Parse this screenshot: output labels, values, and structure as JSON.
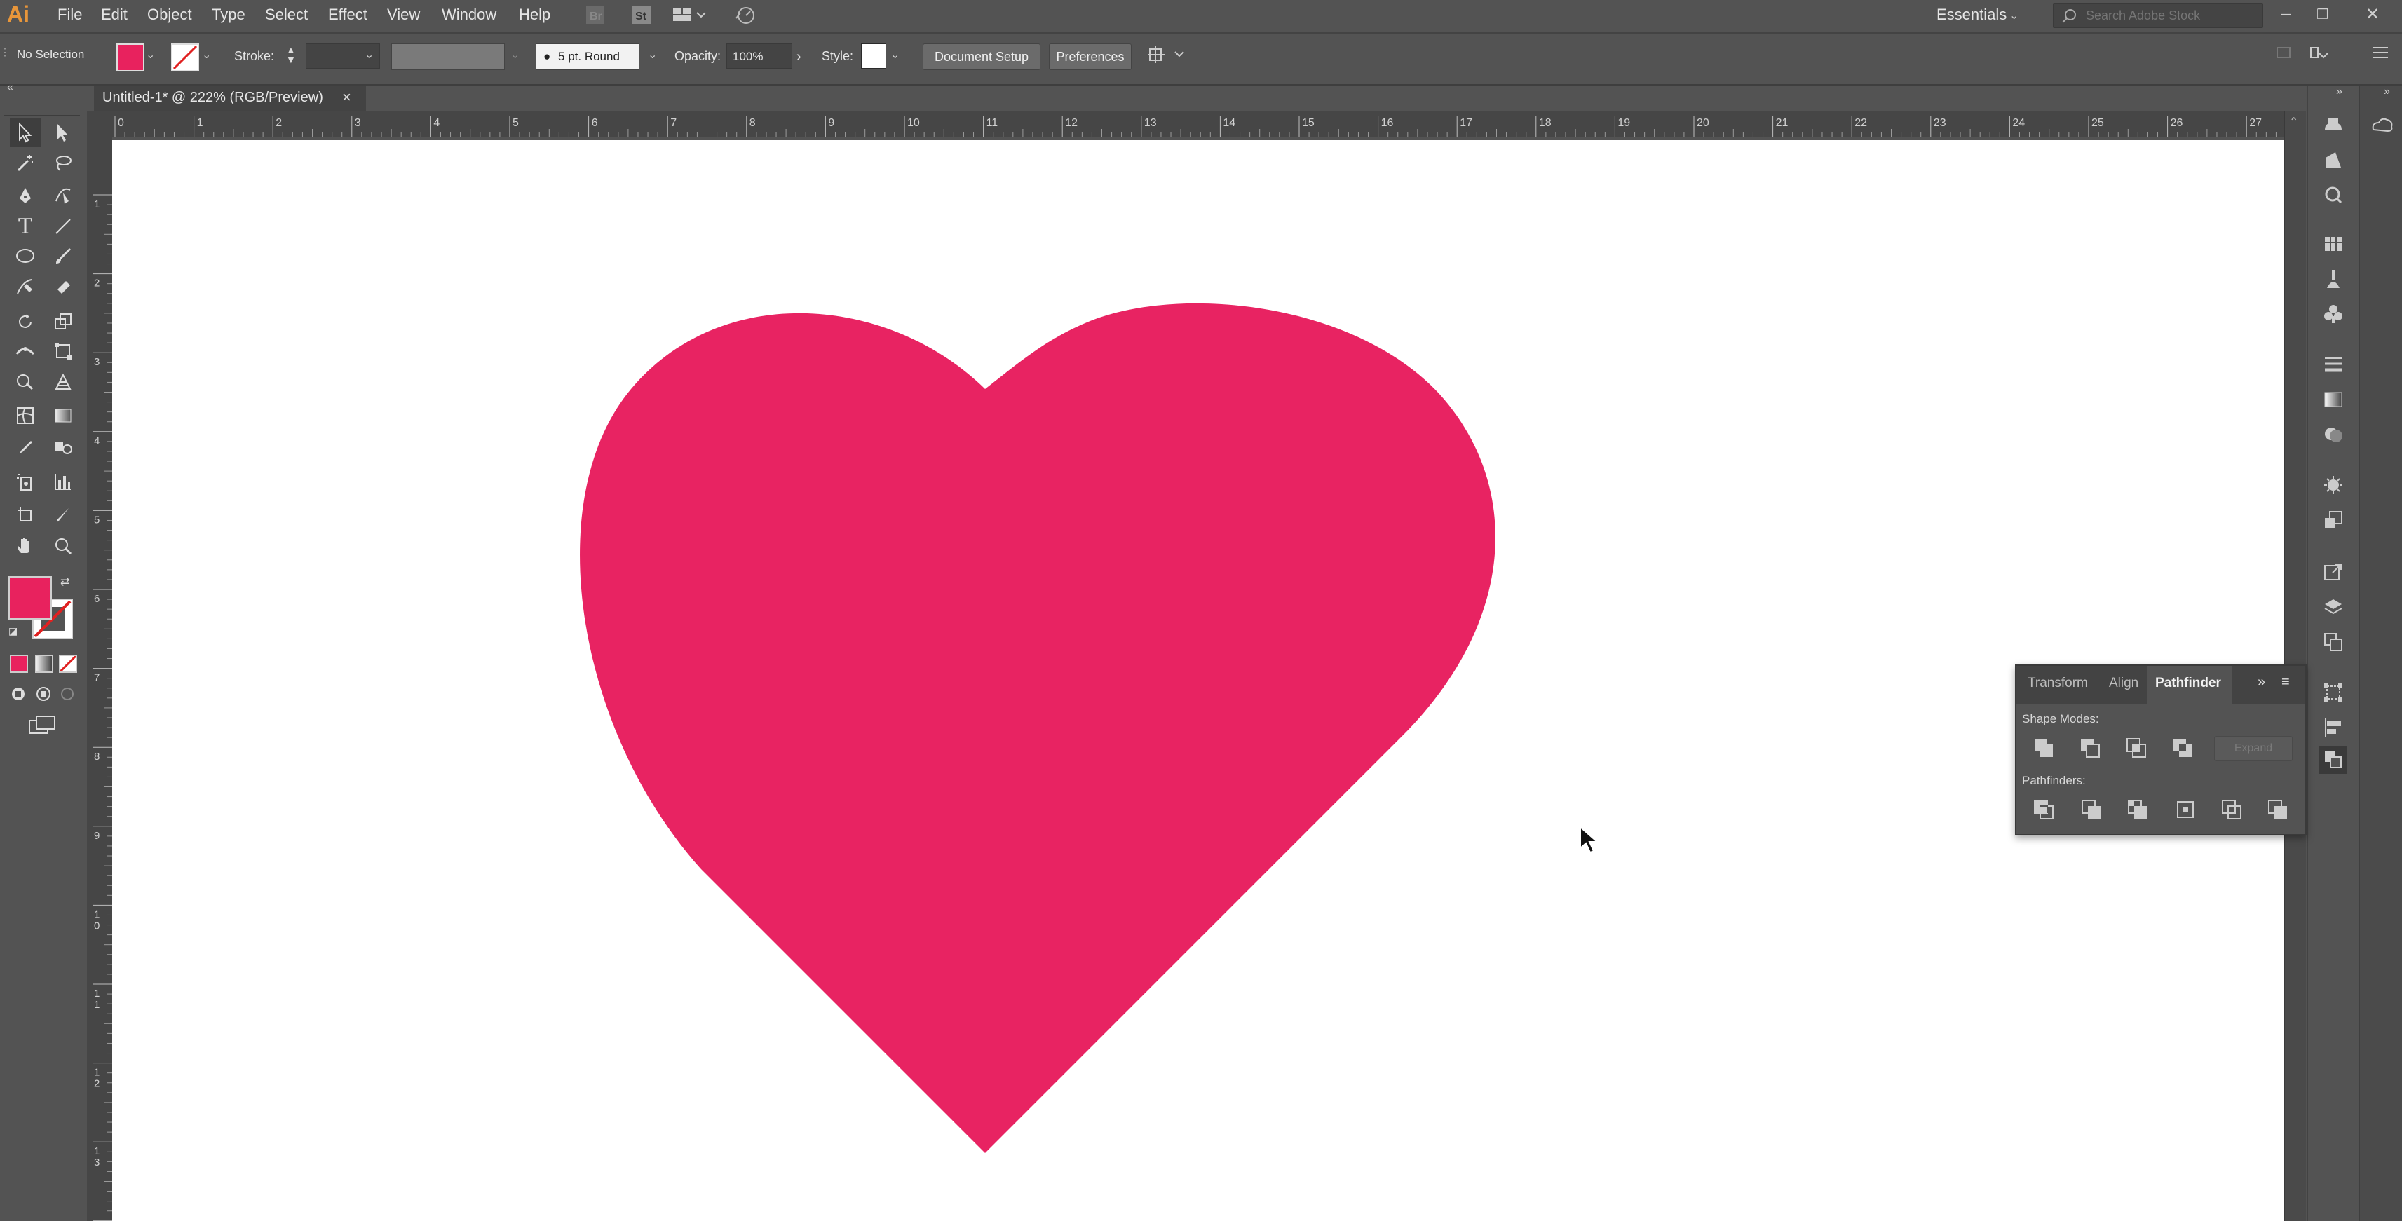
{
  "app": {
    "logo_text": "Ai"
  },
  "menu": [
    "File",
    "Edit",
    "Object",
    "Type",
    "Select",
    "Effect",
    "View",
    "Window",
    "Help"
  ],
  "menubar_right": {
    "workspace": "Essentials",
    "search_placeholder": "Search Adobe Stock"
  },
  "controlbar": {
    "selection_status": "No Selection",
    "stroke_label": "Stroke:",
    "stroke_weight": "",
    "brush": "5 pt. Round",
    "opacity_label": "Opacity:",
    "opacity_value": "100%",
    "style_label": "Style:",
    "document_setup": "Document Setup",
    "preferences": "Preferences"
  },
  "document": {
    "tab_title": "Untitled-1* @ 222% (RGB/Preview)",
    "close": "×"
  },
  "rulers": {
    "horizontal": [
      "0",
      "1",
      "2",
      "3",
      "4",
      "5",
      "6",
      "7",
      "8",
      "9",
      "10",
      "11",
      "12",
      "13",
      "14",
      "15",
      "16",
      "17",
      "18",
      "19",
      "20",
      "21",
      "22",
      "23",
      "24",
      "25",
      "26",
      "27"
    ],
    "vertical": [
      "1",
      "2",
      "3",
      "4",
      "5",
      "6",
      "7",
      "8",
      "9",
      "1\n0",
      "1\n1",
      "1\n2",
      "1\n3",
      "1"
    ]
  },
  "colors": {
    "fill": "#e8225e",
    "heart": "#e82362",
    "accent_logo": "#e8963a"
  },
  "pathfinder_panel": {
    "tabs": [
      "Transform",
      "Align",
      "Pathfinder"
    ],
    "active_tab": "Pathfinder",
    "shape_modes_label": "Shape Modes:",
    "pathfinders_label": "Pathfinders:",
    "expand_label": "Expand"
  },
  "icons": {
    "tools": [
      "selection-tool-icon",
      "direct-selection-tool-icon",
      "magic-wand-tool-icon",
      "lasso-tool-icon",
      "pen-tool-icon",
      "curvature-tool-icon",
      "type-tool-icon",
      "line-tool-icon",
      "ellipse-tool-icon",
      "paintbrush-tool-icon",
      "shaper-tool-icon",
      "eraser-tool-icon",
      "rotate-tool-icon",
      "scale-tool-icon",
      "width-tool-icon",
      "free-transform-tool-icon",
      "shape-builder-tool-icon",
      "perspective-grid-tool-icon",
      "mesh-tool-icon",
      "gradient-tool-icon",
      "eyedropper-tool-icon",
      "blend-tool-icon",
      "symbol-sprayer-tool-icon",
      "column-graph-tool-icon",
      "artboard-tool-icon",
      "slice-tool-icon",
      "hand-tool-icon",
      "zoom-tool-icon"
    ]
  }
}
